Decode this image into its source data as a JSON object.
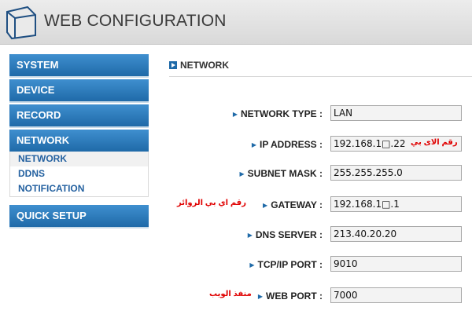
{
  "header": {
    "title": "WEB CONFIGURATION",
    "logo_icon": "folder-icon"
  },
  "sidebar": {
    "items": [
      {
        "label": "SYSTEM"
      },
      {
        "label": "DEVICE"
      },
      {
        "label": "RECORD"
      },
      {
        "label": "NETWORK"
      },
      {
        "label": "QUICK SETUP"
      }
    ],
    "network_submenu": [
      {
        "label": "NETWORK",
        "selected": true
      },
      {
        "label": "DDNS",
        "selected": false
      },
      {
        "label": "NOTIFICATION",
        "selected": false
      }
    ]
  },
  "main": {
    "section_title": "NETWORK",
    "fields": [
      {
        "label": "NETWORK TYPE :",
        "value": "LAN"
      },
      {
        "label": "IP ADDRESS :",
        "value": "192.168.1□.22",
        "annotation": "رقم الاى بي"
      },
      {
        "label": "SUBNET MASK :",
        "value": "255.255.255.0"
      },
      {
        "label": "GATEWAY :",
        "value": "192.168.1□.1",
        "annotation": "رقم اي بي الروائر"
      },
      {
        "label": "DNS SERVER :",
        "value": "213.40.20.20"
      },
      {
        "label": "TCP/IP PORT :",
        "value": "9010"
      },
      {
        "label": "WEB PORT :",
        "value": "7000",
        "annotation": "منفذ الويب"
      }
    ]
  },
  "colors": {
    "menu_blue": "#1f6aa8",
    "annotation_red": "#e00000"
  }
}
